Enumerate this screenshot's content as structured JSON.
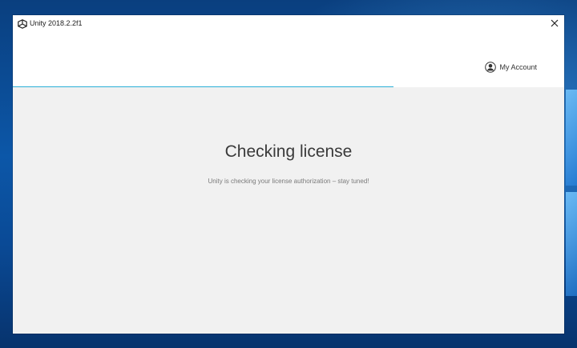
{
  "window": {
    "title": "Unity 2018.2.2f1",
    "app_icon": "unity-logo-icon",
    "close_icon": "close-icon"
  },
  "header": {
    "account_label": "My Account",
    "account_icon": "user-circle-icon"
  },
  "progress": {
    "fraction": 0.69,
    "color": "#2ab0d8"
  },
  "main": {
    "heading": "Checking license",
    "message": "Unity is checking your license authorization – stay tuned!"
  },
  "colors": {
    "content_bg": "#f1f1f1",
    "header_bg": "#ffffff",
    "desktop_bg": "#0c57a8"
  }
}
